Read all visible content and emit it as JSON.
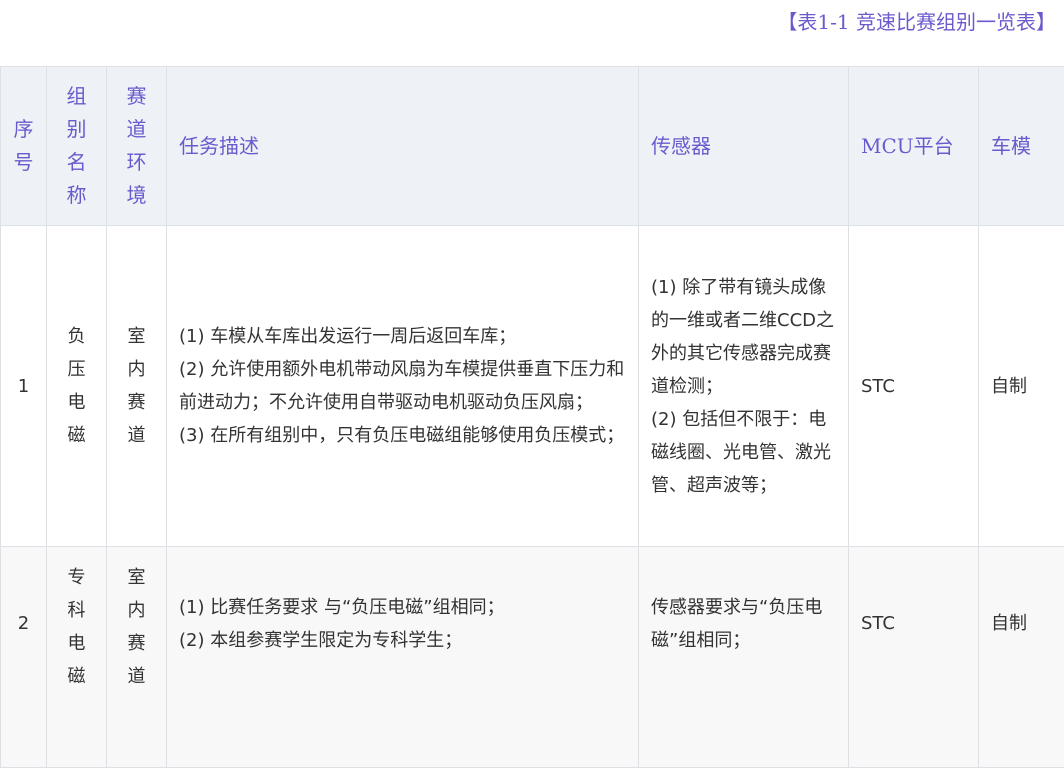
{
  "caption": "【表1-1 竞速比赛组别一览表】",
  "headers": {
    "index": "序号",
    "group": "组别名称",
    "track": "赛道环境",
    "task": "任务描述",
    "sensor": "传感器",
    "mcu": "MCU平台",
    "car": "车模"
  },
  "rows": [
    {
      "index": "1",
      "group": "负压电磁",
      "track": "室内赛道",
      "task": [
        "(1) 车模从车库出发运行一周后返回车库；",
        "(2) 允许使用额外电机带动风扇为车模提供垂直下压力和前进动力；不允许使用自带驱动电机驱动负压风扇；",
        "(3) 在所有组别中，只有负压电磁组能够使用负压模式；"
      ],
      "sensor": [
        "(1) 除了带有镜头成像的一维或者二维CCD之外的其它传感器完成赛道检测；",
        "(2) 包括但不限于：电磁线圈、光电管、激光管、超声波等；"
      ],
      "mcu": "STC",
      "car": "自制"
    },
    {
      "index": "2",
      "group": "专科电磁",
      "track": "室内赛道",
      "task": [
        "(1) 比赛任务要求 与“负压电磁”组相同；",
        "(2) 本组参赛学生限定为专科学生；"
      ],
      "sensor": [
        "传感器要求与“负压电磁”组相同；"
      ],
      "mcu": "STC",
      "car": "自制"
    }
  ]
}
